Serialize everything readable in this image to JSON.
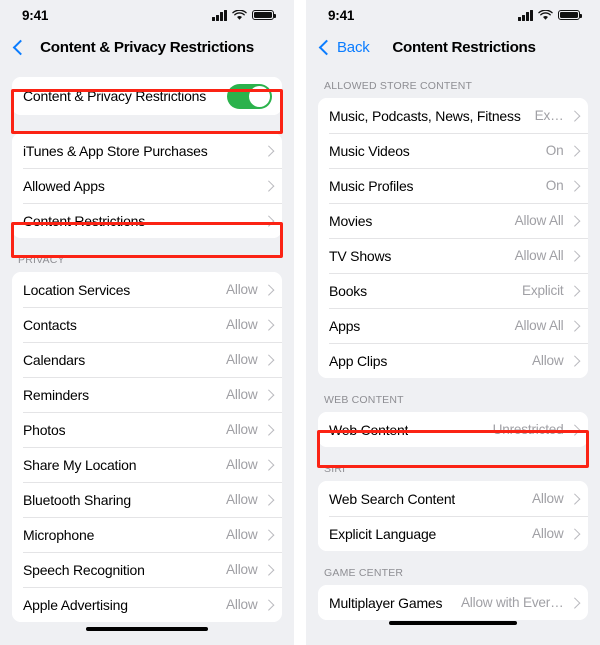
{
  "left_screen": {
    "status_bar": {
      "time": "9:41",
      "signal_icon": "cellular-bars-icon",
      "wifi_icon": "wifi-icon",
      "battery_icon": "battery-full-icon"
    },
    "nav": {
      "back_label": "",
      "title": "Content & Privacy Restrictions"
    },
    "toggle_row": {
      "label": "Content & Privacy Restrictions",
      "state": "on",
      "highlighted": true
    },
    "main_group": [
      {
        "label": "iTunes & App Store Purchases",
        "value": ""
      },
      {
        "label": "Allowed Apps",
        "value": ""
      },
      {
        "label": "Content Restrictions",
        "value": "",
        "highlighted": true
      }
    ],
    "privacy_section_title": "PRIVACY",
    "privacy_group": [
      {
        "label": "Location Services",
        "value": "Allow"
      },
      {
        "label": "Contacts",
        "value": "Allow"
      },
      {
        "label": "Calendars",
        "value": "Allow"
      },
      {
        "label": "Reminders",
        "value": "Allow"
      },
      {
        "label": "Photos",
        "value": "Allow"
      },
      {
        "label": "Share My Location",
        "value": "Allow"
      },
      {
        "label": "Bluetooth Sharing",
        "value": "Allow"
      },
      {
        "label": "Microphone",
        "value": "Allow"
      },
      {
        "label": "Speech Recognition",
        "value": "Allow"
      },
      {
        "label": "Apple Advertising",
        "value": "Allow"
      }
    ]
  },
  "right_screen": {
    "status_bar": {
      "time": "9:41",
      "signal_icon": "cellular-bars-icon",
      "wifi_icon": "wifi-icon",
      "battery_icon": "battery-full-icon"
    },
    "nav": {
      "back_label": "Back",
      "title": "Content Restrictions"
    },
    "store_section_title": "ALLOWED STORE CONTENT",
    "store_group": [
      {
        "label": "Music, Podcasts, News, Fitness",
        "value": "Ex…"
      },
      {
        "label": "Music Videos",
        "value": "On"
      },
      {
        "label": "Music Profiles",
        "value": "On"
      },
      {
        "label": "Movies",
        "value": "Allow All"
      },
      {
        "label": "TV Shows",
        "value": "Allow All"
      },
      {
        "label": "Books",
        "value": "Explicit"
      },
      {
        "label": "Apps",
        "value": "Allow All"
      },
      {
        "label": "App Clips",
        "value": "Allow"
      }
    ],
    "web_section_title": "WEB CONTENT",
    "web_group": [
      {
        "label": "Web Content",
        "value": "Unrestricted",
        "highlighted": true
      }
    ],
    "siri_section_title": "SIRI",
    "siri_group": [
      {
        "label": "Web Search Content",
        "value": "Allow"
      },
      {
        "label": "Explicit Language",
        "value": "Allow"
      }
    ],
    "game_center_section_title": "GAME CENTER",
    "game_center_group": [
      {
        "label": "Multiplayer Games",
        "value": "Allow with Ever…"
      }
    ]
  },
  "colors": {
    "accent_blue": "#0a7cff",
    "toggle_green": "#2bb24c",
    "highlight_red": "#fb2314",
    "background_gray": "#eff0f3",
    "card_white": "#ffffff",
    "secondary_text": "#a0a0a5"
  }
}
